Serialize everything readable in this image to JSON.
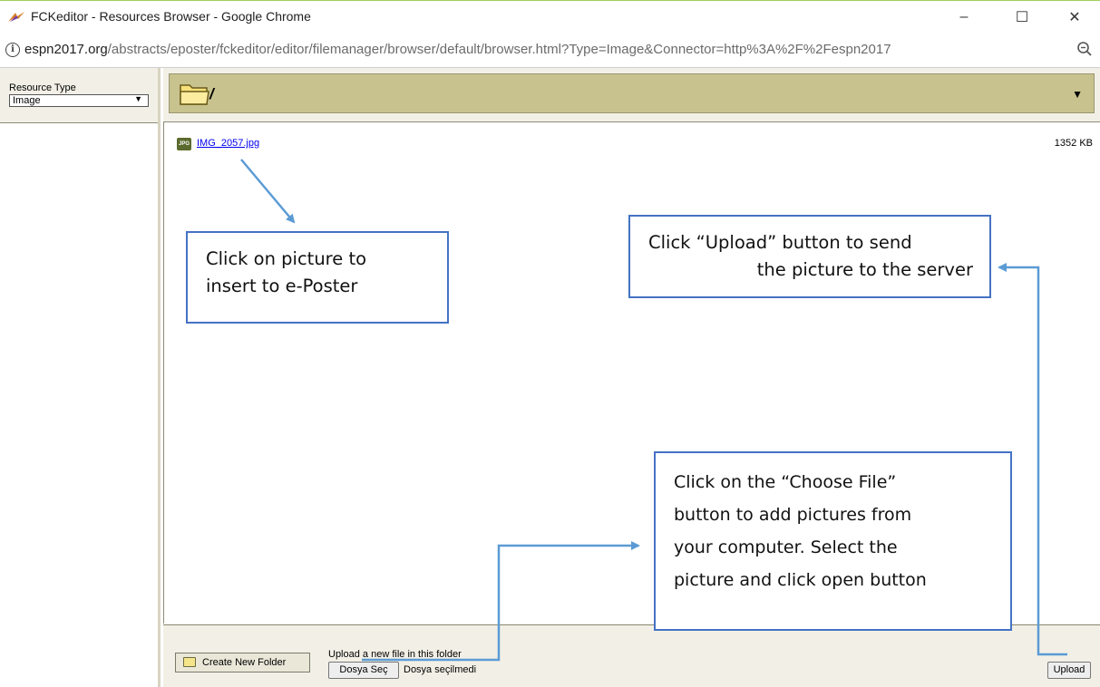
{
  "window": {
    "title": "FCKeditor - Resources Browser - Google Chrome",
    "minimize_glyph": "–",
    "maximize_glyph": "☐",
    "close_glyph": "✕"
  },
  "address": {
    "url_host": "espn2017.org",
    "url_path": "/abstracts/eposter/fckeditor/editor/filemanager/browser/default/browser.html?Type=Image&Connector=http%3A%2F%2Fespn2017"
  },
  "resource_type": {
    "label": "Resource Type",
    "selected": "Image"
  },
  "folder": {
    "path": "/"
  },
  "files": [
    {
      "name": "IMG_2057.jpg",
      "size": "1352 KB",
      "icon": "jpg-icon"
    }
  ],
  "bottom": {
    "create_folder_label": "Create New Folder",
    "upload_prompt": "Upload a new file in this folder",
    "choose_file_label": "Dosya Seç",
    "no_file_label": "Dosya seçilmedi",
    "upload_button_label": "Upload"
  },
  "annotations": {
    "callout_1": [
      "Click on picture to",
      "insert to e-Poster"
    ],
    "callout_2": [
      "Click “Upload” button to send",
      "the picture to the server"
    ],
    "callout_3": [
      "Click on the “Choose File”",
      "button to add pictures from",
      "your computer. Select the",
      "picture and click open button"
    ]
  },
  "colors": {
    "folder_bar": "#c8c38e",
    "panel_bg": "#f2f0e6",
    "callout_border": "#4472c4",
    "arrow": "#5b9bd5"
  }
}
